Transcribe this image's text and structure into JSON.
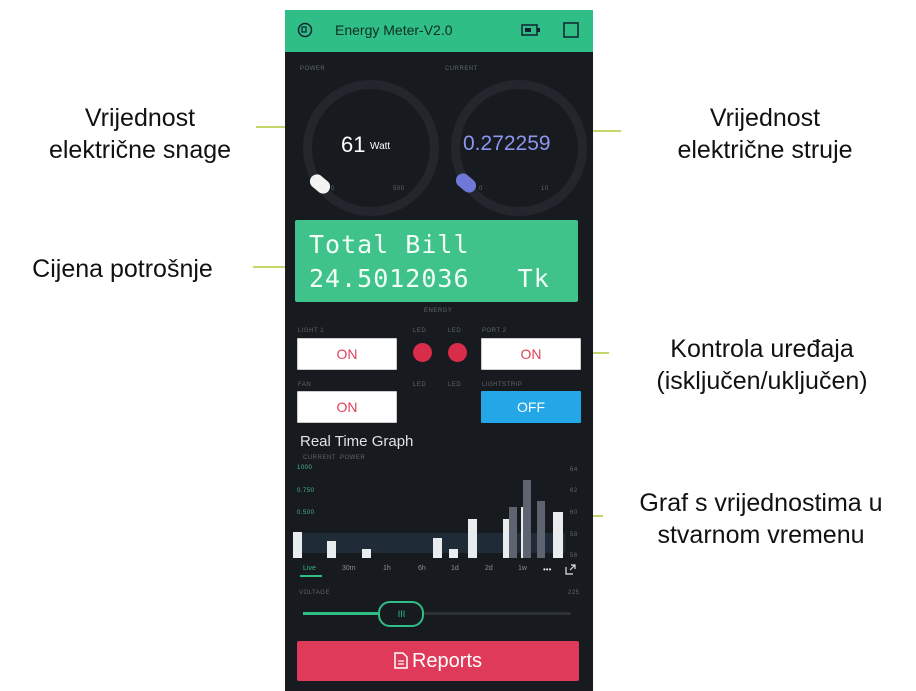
{
  "annotations": {
    "power": [
      "Vrijednost",
      "električne snage"
    ],
    "current": [
      "Vrijednost",
      "električne struje"
    ],
    "bill": "Cijena potrošnje",
    "control": [
      "Kontrola uređaja",
      "(isključen/uključen)"
    ],
    "graph": [
      "Graf s vrijednostima u",
      "stvarnom vremenu"
    ]
  },
  "app": {
    "title": "Energy Meter-V2.0",
    "power_gauge": {
      "label": "POWER",
      "value": "61",
      "unit": "Watt",
      "min": "0",
      "max": "500"
    },
    "current_gauge": {
      "label": "CURRENT",
      "value": "0.272259",
      "min": "0",
      "max": "10"
    },
    "lcd": {
      "line1": "Total Bill",
      "line2": "24.5012036   Tk"
    },
    "lcd_caption": "ENERGY",
    "controls": {
      "light1_label": "LIGHT 1",
      "light1": "ON",
      "led1_label": "LED",
      "led2_label": "LED",
      "port2_label": "PORT 2",
      "port2": "ON",
      "fan_label": "FAN",
      "fan": "ON",
      "led3_label": "LED",
      "led4_label": "LED",
      "lightstrip_label": "LIGHTSTRIP",
      "lightstrip": "OFF"
    },
    "graph": {
      "title": "Real Time Graph",
      "legend": [
        "CURRENT",
        "POWER"
      ],
      "y_left": [
        "1000",
        "0.750",
        "0.500"
      ],
      "y_right": [
        "64",
        "62",
        "60",
        "58",
        "56"
      ],
      "tabs": [
        "Live",
        "30m",
        "1h",
        "6h",
        "1d",
        "2d",
        "1w"
      ],
      "more": "•••"
    },
    "slider": {
      "label": "VOLTAGE",
      "max_label": "225",
      "position": 0.36
    },
    "reports_label": "Reports"
  },
  "chart_data": {
    "type": "bar",
    "title": "Real Time Graph",
    "series": [
      {
        "name": "CURRENT"
      },
      {
        "name": "POWER"
      }
    ],
    "bar_heights_relative": [
      0.28,
      0.18,
      0.1,
      0.22,
      0.1,
      0.42,
      0.42,
      0.55,
      0.5,
      0.55,
      0.85,
      0.62
    ]
  },
  "colors": {
    "accent": "#2fbe85",
    "lcd": "#3fc38a",
    "reports": "#e03a5a",
    "led": "#d82c4a",
    "off_button": "#23a7e6",
    "current_value": "#8d95f0"
  },
  "icons": {
    "device": "device-icon",
    "battery": "battery-icon",
    "square": "square-icon",
    "reports": "document-icon",
    "expand": "expand-icon"
  }
}
